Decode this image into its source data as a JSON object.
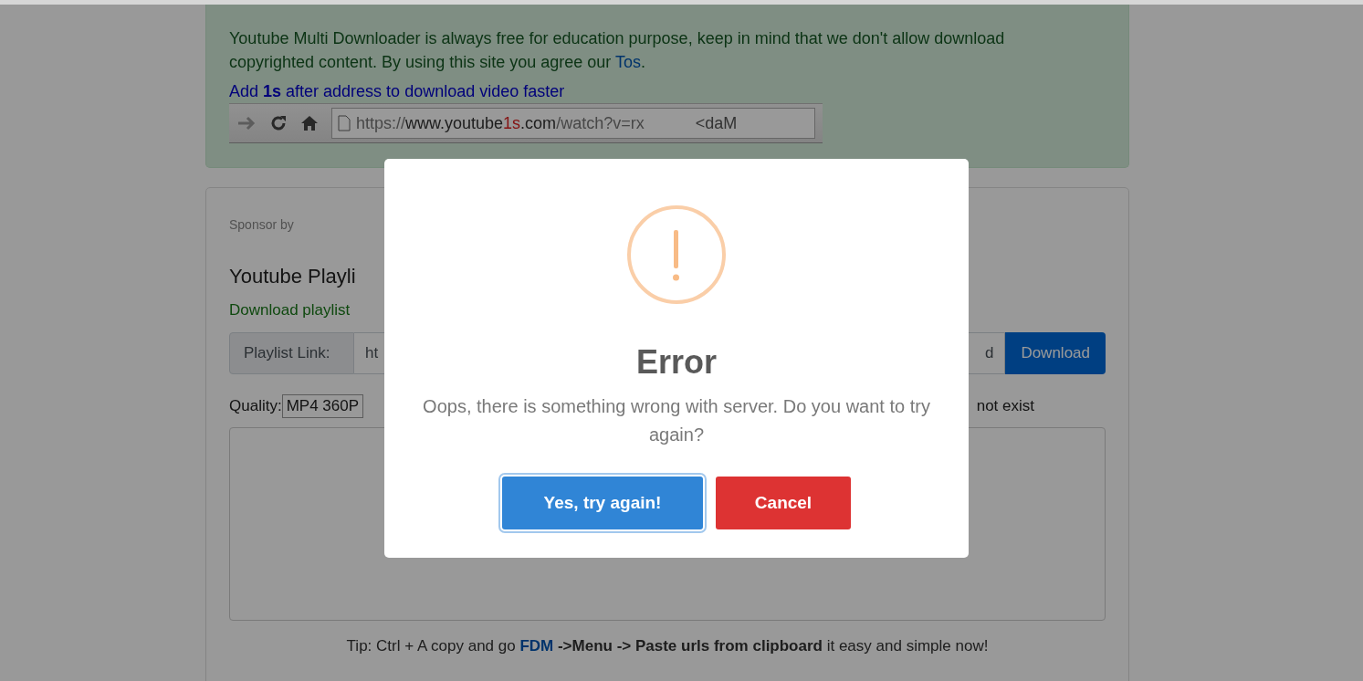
{
  "notice": {
    "text": "Youtube Multi Downloader is always free for education purpose, keep in mind that we don't allow download copyrighted content. By using this site you agree our ",
    "link": "Tos",
    "after": ".",
    "hint": "Add **1s** after address to download video faster",
    "address_bar": {
      "parts": [
        {
          "text": "https://",
          "kind": "dim"
        },
        {
          "text": "www.youtube",
          "kind": "host"
        },
        {
          "text": "1s",
          "kind": "accent"
        },
        {
          "text": ".com",
          "kind": "host"
        },
        {
          "text": "/watch?v=rx",
          "kind": "dim"
        }
      ],
      "tail": "<daM"
    }
  },
  "card": {
    "sponsor": "Sponsor by",
    "title": "Youtube Playli",
    "subtitle": "Download playlist",
    "link_label": "Playlist Link:",
    "link_value": "ht",
    "link_end": "d",
    "download_button": "Download",
    "quality_label": "Quality:",
    "quality_value": "MP4 360P",
    "quality_note": "not exist",
    "tip": "Tip: Ctrl + A copy and go ",
    "tip_link": "FDM",
    "tip_rest": " **->Menu -> Paste urls from clipboard** it easy and simple now!"
  },
  "dialog": {
    "title": "Error",
    "message": "Oops, there is something wrong with server. Do you want to try again?",
    "confirm": "Yes, try again!",
    "cancel": "Cancel"
  }
}
